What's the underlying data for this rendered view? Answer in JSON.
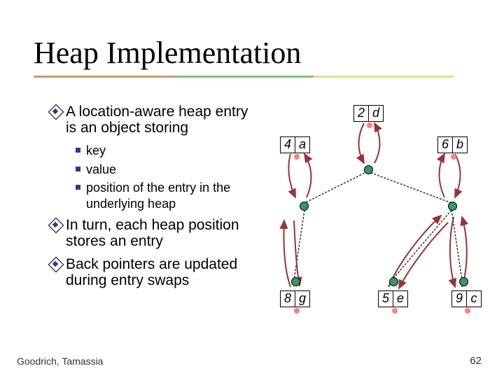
{
  "title": "Heap Implementation",
  "bullets": {
    "b1": "A location-aware heap entry is an object storing",
    "b2": "In turn, each heap position stores an entry",
    "b3": "Back pointers are updated during entry swaps",
    "sub1": "key",
    "sub2": "value",
    "sub3": "position of the entry in the underlying heap"
  },
  "footer": "Goodrich, Tamassia",
  "page": "62",
  "nodes": {
    "n1k": "2",
    "n1v": "d",
    "n2k": "4",
    "n2v": "a",
    "n3k": "6",
    "n3v": "b",
    "n4k": "8",
    "n4v": "g",
    "n5k": "5",
    "n5v": "e",
    "n6k": "9",
    "n6v": "c"
  },
  "chart_data": {
    "type": "diagram",
    "description": "Location-aware heap: tree positions link to entry objects (key,value) and back",
    "tree_edges": [
      [
        "root",
        "left"
      ],
      [
        "root",
        "right"
      ],
      [
        "left",
        "ll"
      ],
      [
        "right",
        "rl"
      ],
      [
        "right",
        "rr"
      ]
    ],
    "entries": [
      {
        "key": 2,
        "value": "d",
        "pos": "root"
      },
      {
        "key": 4,
        "value": "a",
        "pos": "left"
      },
      {
        "key": 6,
        "value": "b",
        "pos": "right"
      },
      {
        "key": 8,
        "value": "g",
        "pos": "ll"
      },
      {
        "key": 5,
        "value": "e",
        "pos": "rl"
      },
      {
        "key": 9,
        "value": "c",
        "pos": "rr"
      }
    ]
  }
}
